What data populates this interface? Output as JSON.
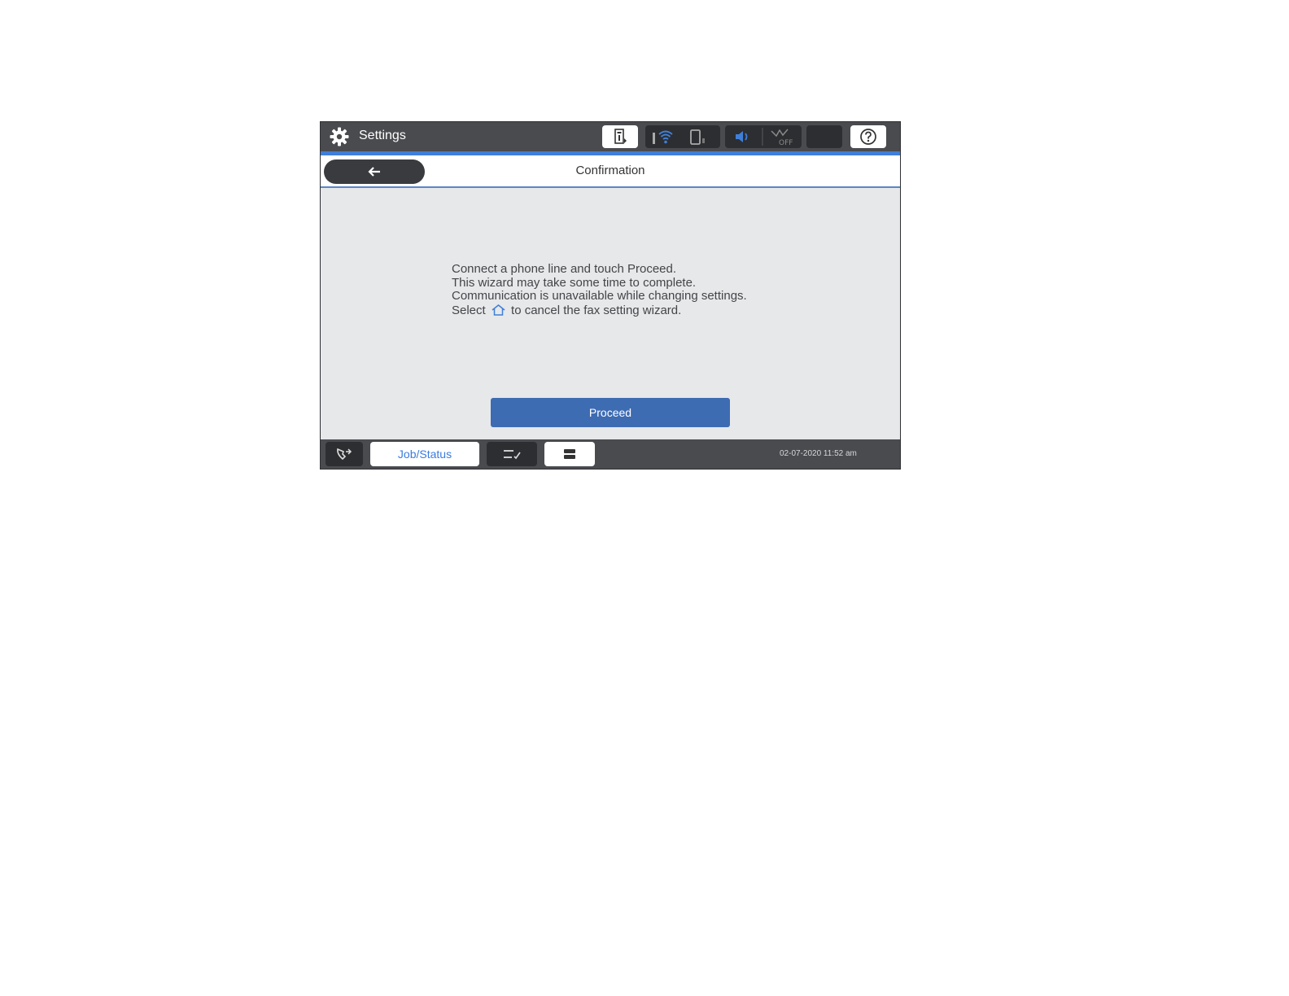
{
  "topbar": {
    "title": "Settings",
    "icons": [
      "gear-icon",
      "printer-status-icon",
      "wifi-icon",
      "wifi-direct-icon",
      "speaker-icon",
      "fax-off-icon",
      "sleep-icon",
      "help-icon"
    ]
  },
  "header": {
    "title": "Confirmation",
    "back_icon": "back-arrow-icon"
  },
  "message": {
    "line1": "Connect a phone line and touch Proceed.",
    "line2": "This wizard may take some time to complete.",
    "line3": "Communication is unavailable while changing settings.",
    "line4_before": "Select",
    "line4_after": "to cancel the fax setting wizard."
  },
  "proceed_label": "Proceed",
  "bottombar": {
    "job_status_label": "Job/Status",
    "datetime": "02-07-2020 11:52 am"
  },
  "colors": {
    "bar": "#4a4b4f",
    "accent": "#3f7fd8",
    "button": "#3e6cb3",
    "link": "#3a7be0"
  }
}
